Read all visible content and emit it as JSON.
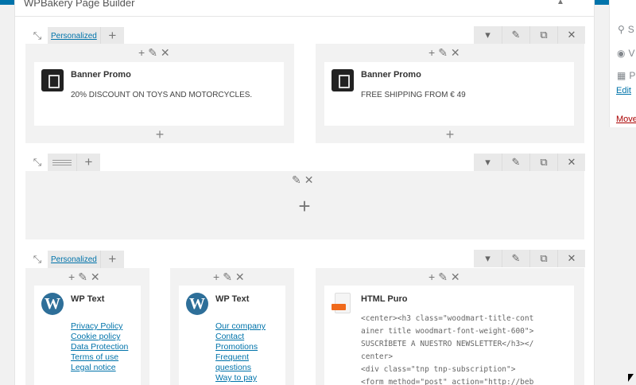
{
  "panel": {
    "title": "WPBakery Page Builder",
    "toggle_icon": "caret-up-icon"
  },
  "accent_color": "#0073aa",
  "rows": [
    {
      "layout_label": "Personalized",
      "columns": [
        {
          "element": {
            "type": "banner-promo",
            "title": "Banner Promo",
            "text": "20% DISCOUNT ON TOYS AND MOTORCYCLES."
          }
        },
        {
          "element": {
            "type": "banner-promo",
            "title": "Banner Promo",
            "text": "FREE SHIPPING FROM € 49"
          }
        }
      ]
    },
    {
      "layout_label": "",
      "columns": []
    },
    {
      "layout_label": "Personalized",
      "columns": [
        {
          "element": {
            "type": "wp-text",
            "title": "WP Text",
            "links": [
              "Privacy Policy",
              "Cookie policy",
              "Data Protection",
              "Terms of use",
              "Legal notice"
            ]
          }
        },
        {
          "element": {
            "type": "wp-text",
            "title": "WP Text",
            "links": [
              "Our company",
              "Contact",
              "Promotions",
              "Frequent",
              "questions",
              "Way to pay"
            ]
          }
        },
        {
          "element": {
            "type": "html",
            "title": "HTML Puro",
            "code": [
              "<center><h3 class=\"woodmart-title-cont",
              "ainer title woodmart-font-weight-600\">",
              "SUSCRÍBETE A NUESTRO NEWSLETTER</h3></",
              "center>",
              "<div class=\"tnp tnp-subscription\">",
              "<form method=\"post\" action=\"http://beb"
            ]
          }
        }
      ]
    }
  ],
  "row_controls": [
    "caret-down-icon",
    "pencil-icon",
    "copy-icon",
    "close-icon"
  ],
  "sidebar": {
    "items": [
      {
        "icon": "pin-icon",
        "label": "S"
      },
      {
        "icon": "eye-icon",
        "label": "V"
      },
      {
        "icon": "calendar-icon",
        "label": "P"
      }
    ],
    "edit_link": "Edit",
    "move_link": "Move"
  }
}
